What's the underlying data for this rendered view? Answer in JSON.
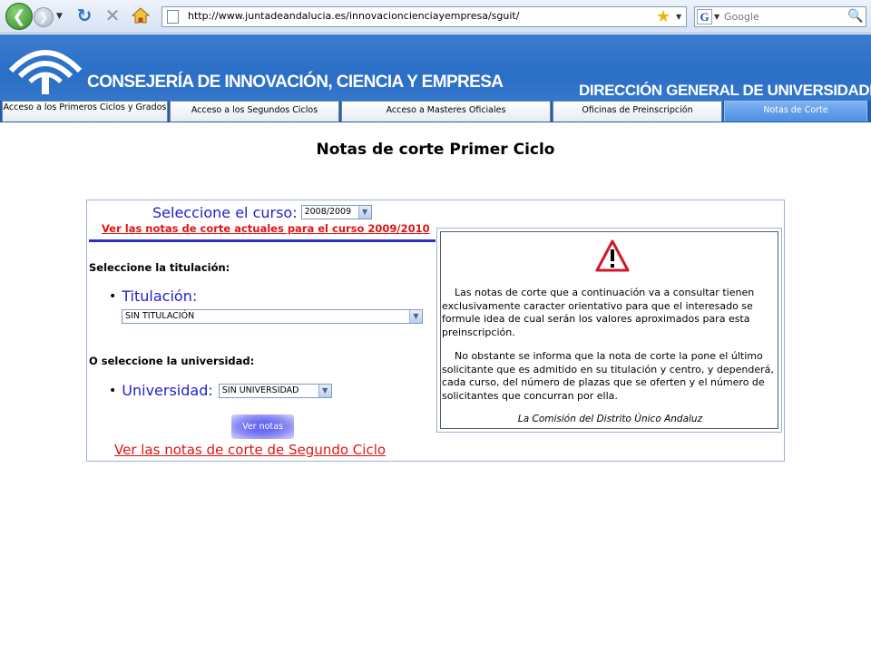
{
  "browser": {
    "url": "http://www.juntadeandalucia.es/innovacioncienciayempresa/sguit/",
    "search_placeholder": "Google",
    "search_engine_letter": "G"
  },
  "header": {
    "consejeria": "CONSEJERÍA DE INNOVACIÓN, CIENCIA Y EMPRESA",
    "direccion": "DIRECCIÓN GENERAL DE UNIVERSIDADES"
  },
  "tabs": [
    {
      "label": "Acceso a los Primeros Ciclos y Grados",
      "active": false
    },
    {
      "label": "Acceso a los Segundos Ciclos",
      "active": false
    },
    {
      "label": "Acceso a Masteres Oficiales",
      "active": false
    },
    {
      "label": "Oficinas de Preinscripción",
      "active": false
    },
    {
      "label": "Notas de Corte",
      "active": true
    }
  ],
  "page": {
    "title": "Notas de corte Primer Ciclo"
  },
  "form": {
    "curso_label": "Seleccione el curso:",
    "curso_value": "2008/2009",
    "link_actuales": "Ver las notas de corte actuales para el curso 2009/2010",
    "titulacion_heading": "Seleccione la titulación:",
    "titulacion_label": "Titulación:",
    "titulacion_value": "SIN TITULACIÓN",
    "universidad_heading": "O seleccione la universidad:",
    "universidad_label": "Universidad:",
    "universidad_value": "SIN UNIVERSIDAD",
    "ver_button": "Ver notas",
    "link_segundo": "Ver las notas de corte de Segundo Ciclo"
  },
  "notice": {
    "p1": "Las notas de corte que a continuación va a consultar tienen exclusivamente caracter orientativo para que el interesado se formule idea de cual serán los valores aproximados para esta preinscripción.",
    "p2": "No obstante se informa que la nota de corte la pone el último solicitante que es admitido en su titulación y centro, y dependerá, cada curso, del número de plazas que se oferten y el número de solicitantes que concurran por ella.",
    "signature": "La Comisión del Distrito Único Andaluz"
  },
  "colors": {
    "header_blue": "#2a6ec6",
    "label_blue": "#1f1fcc",
    "link_red": "#e01414"
  }
}
